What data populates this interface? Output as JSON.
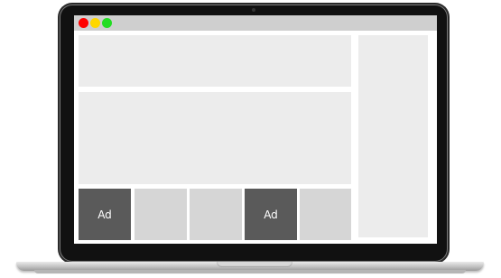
{
  "window": {
    "controls": [
      {
        "name": "close",
        "color": "#ff0000"
      },
      {
        "name": "minimize",
        "color": "#ffd700"
      },
      {
        "name": "maximize",
        "color": "#22dd22"
      }
    ]
  },
  "tiles": [
    {
      "label": "Ad",
      "is_ad": true,
      "color": "#5a5a5a"
    },
    {
      "label": "",
      "is_ad": false,
      "color": "#d6d6d6"
    },
    {
      "label": "",
      "is_ad": false,
      "color": "#d6d6d6"
    },
    {
      "label": "Ad",
      "is_ad": true,
      "color": "#5a5a5a"
    },
    {
      "label": "",
      "is_ad": false,
      "color": "#d6d6d6"
    }
  ],
  "colors": {
    "placeholder": "#ececec",
    "titlebar": "#cfcfcf",
    "bezel": "#111111"
  }
}
